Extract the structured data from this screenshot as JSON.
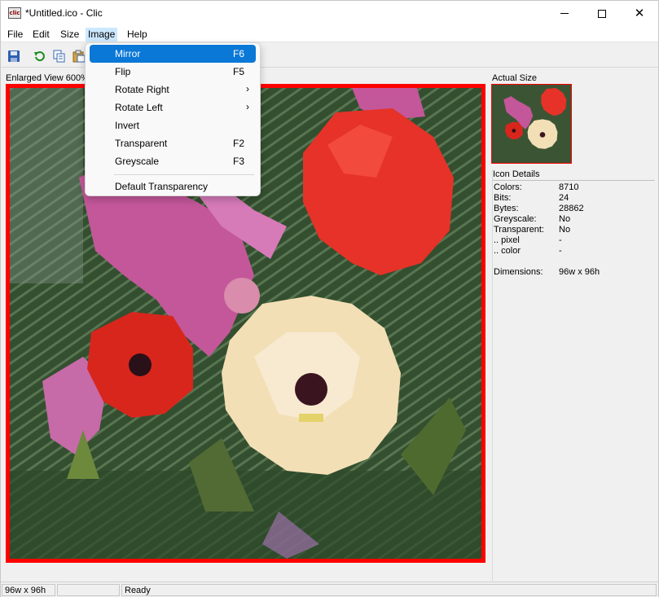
{
  "window": {
    "title": "*Untitled.ico - Clic",
    "app_icon_text": "clic"
  },
  "menubar": {
    "items": [
      {
        "label": "File"
      },
      {
        "label": "Edit"
      },
      {
        "label": "Size"
      },
      {
        "label": "Image"
      },
      {
        "label": "Help"
      }
    ],
    "open_menu": "Image"
  },
  "toolbar": {
    "buttons": [
      {
        "icon": "save-icon"
      },
      {
        "icon": "undo-icon"
      },
      {
        "icon": "copy-icon"
      },
      {
        "icon": "paste-icon"
      }
    ]
  },
  "image_menu": {
    "items": [
      {
        "label": "Mirror",
        "shortcut": "F6",
        "selected": true
      },
      {
        "label": "Flip",
        "shortcut": "F5"
      },
      {
        "label": "Rotate Right",
        "submenu": true
      },
      {
        "label": "Rotate Left",
        "submenu": true
      },
      {
        "label": "Invert",
        "shortcut": ""
      },
      {
        "label": "Transparent",
        "shortcut": "F2"
      },
      {
        "label": "Greyscale",
        "shortcut": "F3"
      },
      {
        "label": "Default Transparency",
        "shortcut": ""
      }
    ],
    "submenu_arrow": "›"
  },
  "enlarged_view": {
    "label": "Enlarged View 600%",
    "border_color": "#ff0000"
  },
  "actual_size": {
    "label": "Actual Size"
  },
  "icon_details": {
    "header": "Icon Details",
    "rows": [
      {
        "key": "Colors:",
        "value": "8710"
      },
      {
        "key": "Bits:",
        "value": "24"
      },
      {
        "key": "Bytes:",
        "value": "28862"
      },
      {
        "key": "Greyscale:",
        "value": "No"
      },
      {
        "key": "Transparent:",
        "value": "No"
      },
      {
        "key": ".. pixel",
        "value": "-"
      },
      {
        "key": ".. color",
        "value": "-"
      },
      {
        "key": "Dimensions:",
        "value": "96w x 96h"
      }
    ]
  },
  "statusbar": {
    "size": "96w x 96h",
    "middle": "",
    "status": "Ready"
  },
  "colors": {
    "menu_highlight": "#0a78d7",
    "menubar_open": "#cce8ff",
    "canvas_border": "#ff0000"
  }
}
